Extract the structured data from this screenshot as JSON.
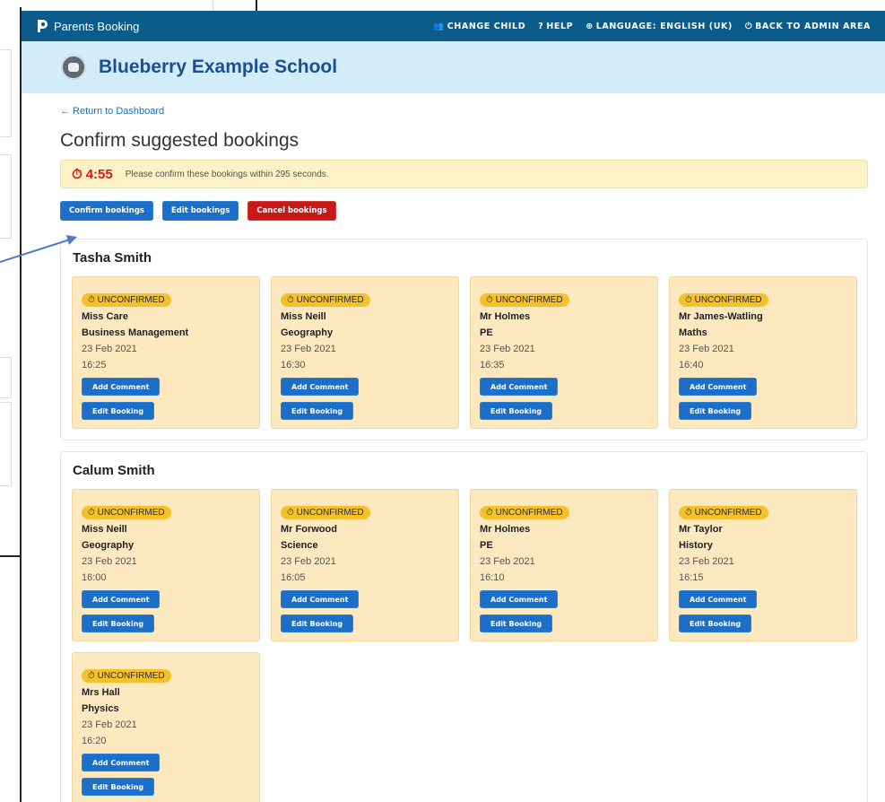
{
  "topbar": {
    "brand": "Parents Booking",
    "nav": [
      {
        "icon": "users-icon",
        "label": "CHANGE CHILD"
      },
      {
        "icon": "help-icon",
        "label": "HELP"
      },
      {
        "icon": "globe-icon",
        "label": "LANGUAGE: ENGLISH (UK)"
      },
      {
        "icon": "power-icon",
        "label": "BACK TO ADMIN AREA"
      }
    ]
  },
  "school": {
    "name": "Blueberry Example School"
  },
  "page": {
    "return_link": "← Return to Dashboard",
    "title": "Confirm suggested bookings"
  },
  "alert": {
    "timer": "4:55",
    "message": "Please confirm these bookings within 295 seconds."
  },
  "actions": {
    "confirm": "Confirm bookings",
    "edit": "Edit bookings",
    "cancel": "Cancel bookings"
  },
  "card_labels": {
    "status": "UNCONFIRMED",
    "add_comment": "Add Comment",
    "edit_booking": "Edit Booking"
  },
  "students": [
    {
      "name": "Tasha Smith",
      "bookings": [
        {
          "teacher": "Miss Care",
          "subject": "Business Management",
          "date": "23 Feb 2021",
          "time": "16:25"
        },
        {
          "teacher": "Miss Neill",
          "subject": "Geography",
          "date": "23 Feb 2021",
          "time": "16:30"
        },
        {
          "teacher": "Mr Holmes",
          "subject": "PE",
          "date": "23 Feb 2021",
          "time": "16:35"
        },
        {
          "teacher": "Mr James-Watling",
          "subject": "Maths",
          "date": "23 Feb 2021",
          "time": "16:40"
        }
      ]
    },
    {
      "name": "Calum Smith",
      "bookings": [
        {
          "teacher": "Miss Neill",
          "subject": "Geography",
          "date": "23 Feb 2021",
          "time": "16:00"
        },
        {
          "teacher": "Mr Forwood",
          "subject": "Science",
          "date": "23 Feb 2021",
          "time": "16:05"
        },
        {
          "teacher": "Mr Holmes",
          "subject": "PE",
          "date": "23 Feb 2021",
          "time": "16:10"
        },
        {
          "teacher": "Mr Taylor",
          "subject": "History",
          "date": "23 Feb 2021",
          "time": "16:15"
        },
        {
          "teacher": "Mrs Hall",
          "subject": "Physics",
          "date": "23 Feb 2021",
          "time": "16:20"
        }
      ]
    }
  ],
  "colors": {
    "topbar": "#0b5c8a",
    "school_bar": "#d3ecf9",
    "primary_button": "#1c6fc9",
    "danger_button": "#c81919",
    "card": "#fde9c0",
    "badge": "#f5c12b",
    "timer": "#d01b1b"
  }
}
